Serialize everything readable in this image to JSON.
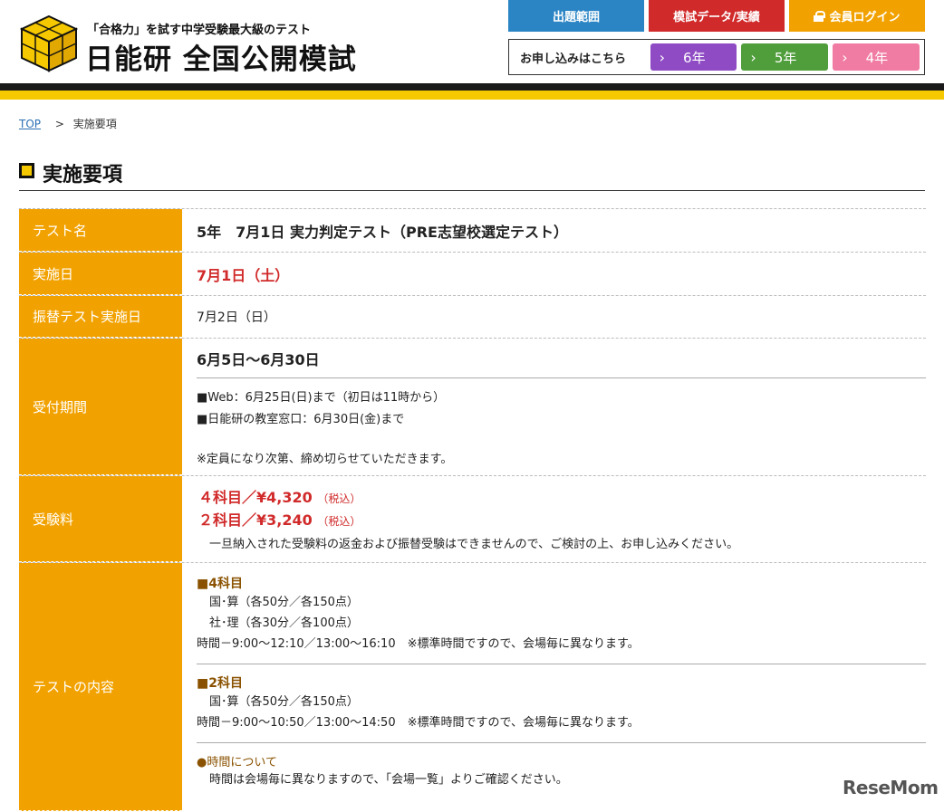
{
  "header": {
    "tagline": "「合格力」を試す中学受験最大級のテスト",
    "logo_main": "日能研 全国公開模試",
    "logo_cube_text": "全国公開模試",
    "nav": {
      "scope": "出題範囲",
      "data": "模試データ/実績",
      "login": "会員ログイン"
    },
    "apply": {
      "label": "お申し込みはこちら",
      "grades": [
        "6年",
        "5年",
        "4年"
      ]
    },
    "colors": {
      "blue": "#2b85c5",
      "red": "#d12a2a",
      "orange": "#f2a200",
      "yellow": "#f5c800"
    }
  },
  "breadcrumb": {
    "home": "TOP",
    "separator": ">",
    "current": "実施要項"
  },
  "page_title": "実施要項",
  "table": {
    "test_name": {
      "label": "テスト名",
      "value": "5年　7月1日 実力判定テスト（PRE志望校選定テスト）"
    },
    "date": {
      "label": "実施日",
      "value": "7月1日（土）"
    },
    "alt_date": {
      "label": "振替テスト実施日",
      "value": "7月2日（日）"
    },
    "reception": {
      "label": "受付期間",
      "period": "6月5日〜6月30日",
      "lines": [
        "■Web：6月25日(日)まで（初日は11時から）",
        "■日能研の教室窓口：6月30日(金)まで"
      ],
      "note": "※定員になり次第、締め切らせていただきます。"
    },
    "fee": {
      "label": "受験料",
      "four": "４科目／¥4,320",
      "two": "２科目／¥3,240",
      "tax": "（税込）",
      "note": "一旦納入された受験料の返金および振替受験はできませんので、ご検討の上、お申し込みください。"
    },
    "content": {
      "label": "テストの内容",
      "four_head": "■4科目",
      "four_lines": [
        "国･算（各50分／各150点）",
        "社･理（各30分／各100点）"
      ],
      "four_time": "時間－9:00〜12:10／13:00〜16:10　※標準時間ですので、会場毎に異なります。",
      "two_head": "■2科目",
      "two_lines": [
        "国･算（各50分／各150点）"
      ],
      "two_time": "時間－9:00〜10:50／13:00〜14:50　※標準時間ですので、会場毎に異なります。",
      "time_head": "●時間について",
      "time_note": "時間は会場毎に異なりますので、「会場一覧」よりご確認ください。"
    }
  },
  "watermark": "ReseMom"
}
